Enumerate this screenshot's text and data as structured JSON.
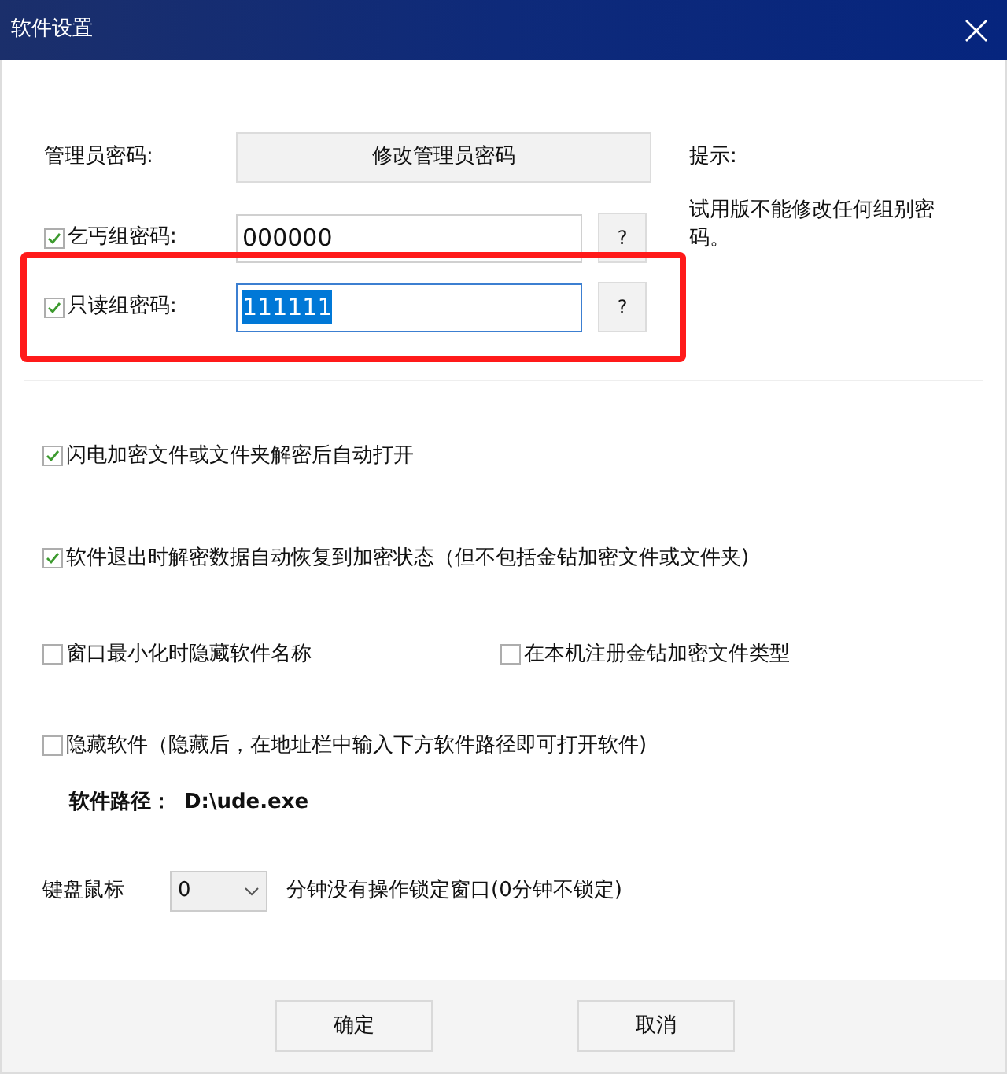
{
  "window": {
    "title": "软件设置"
  },
  "admin": {
    "label": "管理员密码:",
    "button": "修改管理员密码"
  },
  "hint": {
    "title": "提示:",
    "text": "试用版不能修改任何组别密码。"
  },
  "group_passwords": [
    {
      "label": "乞丐组密码:",
      "checked": true,
      "value": "000000",
      "help": "?",
      "value_selected": false,
      "highlighted": false
    },
    {
      "label": "只读组密码:",
      "checked": true,
      "value": "111111",
      "help": "?",
      "value_selected": true,
      "highlighted": true
    }
  ],
  "options": [
    {
      "label": "闪电加密文件或文件夹解密后自动打开",
      "checked": true
    },
    {
      "label": "软件退出时解密数据自动恢复到加密状态（但不包括金钻加密文件或文件夹)",
      "checked": true
    }
  ],
  "option_pair": [
    {
      "label": "窗口最小化时隐藏软件名称",
      "checked": false
    },
    {
      "label": "在本机注册金钻加密文件类型",
      "checked": false
    }
  ],
  "hide_option": {
    "label": "隐藏软件（隐藏后，在地址栏中输入下方软件路径即可打开软件)",
    "checked": false
  },
  "path": {
    "label": "软件路径：",
    "value": "D:\\ude.exe"
  },
  "lock": {
    "label": "键盘鼠标",
    "value": "0",
    "suffix": "分钟没有操作锁定窗口(0分钟不锁定)"
  },
  "buttons": [
    "确定",
    "取消"
  ]
}
